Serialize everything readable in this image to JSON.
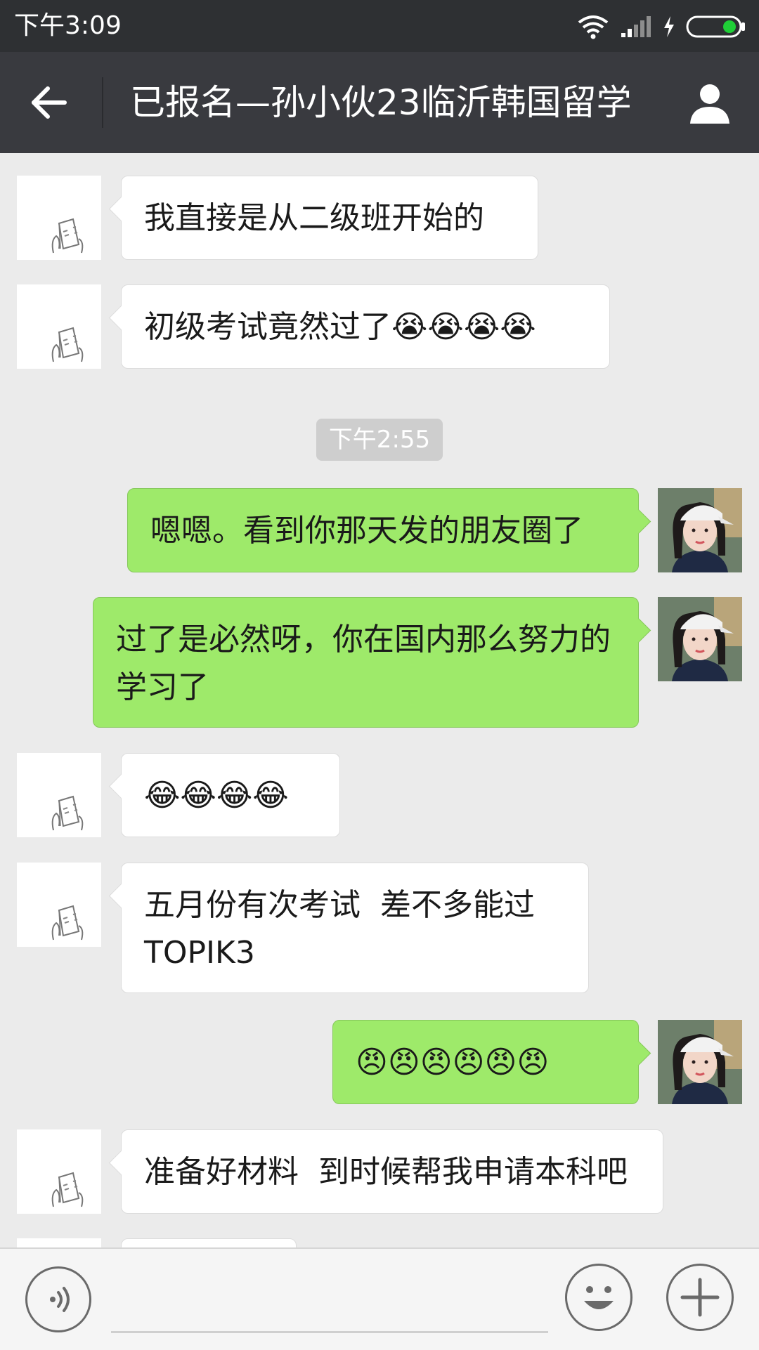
{
  "status_bar": {
    "time": "下午3:09"
  },
  "title_bar": {
    "title": "已报名—孙小伙23临沂韩国留学"
  },
  "messages": [
    {
      "side": "in",
      "text": "我直接是从二级班开始的"
    },
    {
      "side": "in",
      "text": "初级考试竟然过了😭😭😭😭"
    },
    {
      "side": "out",
      "text": "嗯嗯。看到你那天发的朋友圈了"
    },
    {
      "side": "out",
      "text": "过了是必然呀，你在国内那么努力的学习了"
    },
    {
      "side": "in",
      "text": "😂😂😂😂"
    },
    {
      "side": "in",
      "text": "五月份有次考试  差不多能过TOPIK3"
    },
    {
      "side": "out",
      "text": "😠😠😠😠😠😠"
    },
    {
      "side": "in",
      "text": "准备好材料  到时候帮我申请本科吧"
    }
  ],
  "timestamp": "下午2:55",
  "icons": {
    "back": "back-arrow-icon",
    "profile": "contact-profile-icon",
    "voice": "voice-input-icon",
    "emoji": "emoji-icon",
    "more": "plus-icon",
    "wifi": "wifi-icon",
    "signal": "signal-icon",
    "battery": "battery-icon"
  },
  "colors": {
    "sent_bubble": "#9eea6a",
    "received_bubble": "#ffffff",
    "title_bar": "#393a3f",
    "status_bar": "#2e3033",
    "chat_background": "#ebebeb",
    "battery_level": "#1fcf37"
  }
}
